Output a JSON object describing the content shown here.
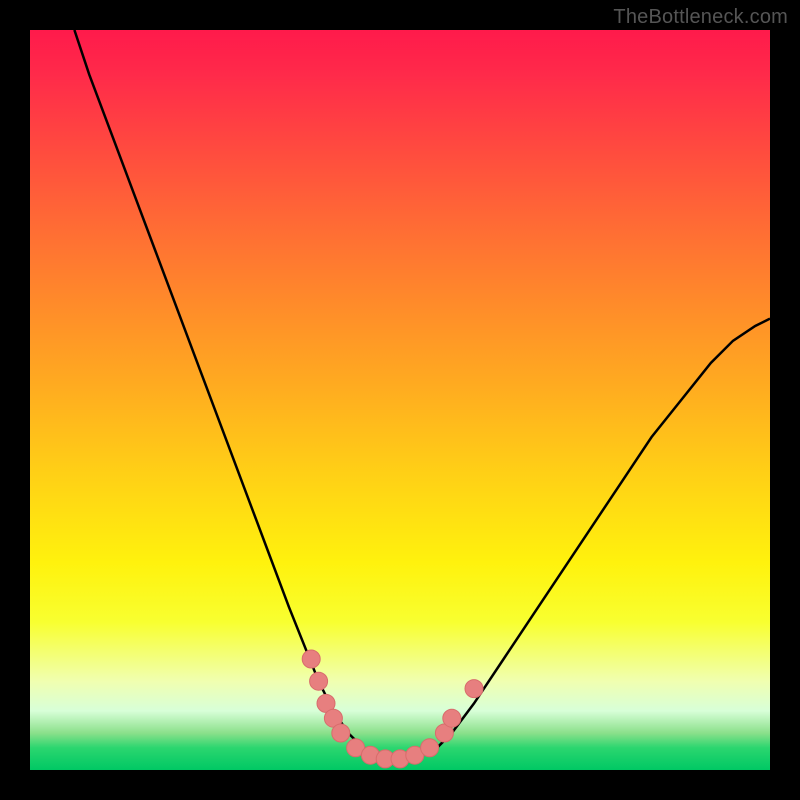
{
  "watermark": {
    "text": "TheBottleneck.com"
  },
  "colors": {
    "frame": "#000000",
    "curve_stroke": "#000000",
    "marker_fill": "#e77f7f",
    "marker_stroke": "#d86c6c"
  },
  "chart_data": {
    "type": "line",
    "title": "",
    "xlabel": "",
    "ylabel": "",
    "xlim": [
      0,
      100
    ],
    "ylim": [
      0,
      100
    ],
    "grid": false,
    "legend": false,
    "series": [
      {
        "name": "bottleneck-curve",
        "x": [
          6,
          8,
          11,
          14,
          17,
          20,
          23,
          26,
          29,
          32,
          35,
          37,
          39,
          41,
          43,
          45,
          47,
          49,
          51,
          53,
          55,
          57,
          60,
          64,
          68,
          72,
          76,
          80,
          84,
          88,
          92,
          95,
          98,
          100
        ],
        "y": [
          100,
          94,
          86,
          78,
          70,
          62,
          54,
          46,
          38,
          30,
          22,
          17,
          12,
          8,
          5,
          3,
          2,
          1.5,
          1.5,
          2,
          3,
          5,
          9,
          15,
          21,
          27,
          33,
          39,
          45,
          50,
          55,
          58,
          60,
          61
        ]
      }
    ],
    "markers": [
      {
        "x": 38,
        "y": 15
      },
      {
        "x": 39,
        "y": 12
      },
      {
        "x": 40,
        "y": 9
      },
      {
        "x": 41,
        "y": 7
      },
      {
        "x": 42,
        "y": 5
      },
      {
        "x": 44,
        "y": 3
      },
      {
        "x": 46,
        "y": 2
      },
      {
        "x": 48,
        "y": 1.5
      },
      {
        "x": 50,
        "y": 1.5
      },
      {
        "x": 52,
        "y": 2
      },
      {
        "x": 54,
        "y": 3
      },
      {
        "x": 56,
        "y": 5
      },
      {
        "x": 57,
        "y": 7
      },
      {
        "x": 60,
        "y": 11
      }
    ]
  }
}
